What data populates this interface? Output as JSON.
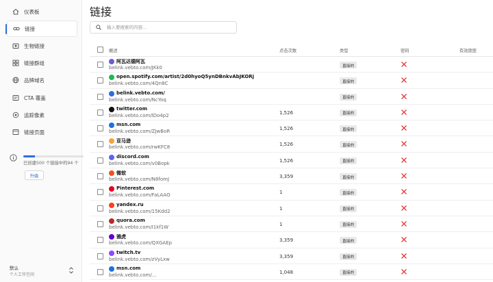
{
  "sidebar": {
    "items": [
      {
        "label": "仪表板",
        "icon": "home-icon",
        "active": false
      },
      {
        "label": "链接",
        "icon": "link-icon",
        "active": true
      },
      {
        "label": "生物链接",
        "icon": "bio-link-icon",
        "active": false
      },
      {
        "label": "链接群组",
        "icon": "grid-icon",
        "active": false
      },
      {
        "label": "品牌域名",
        "icon": "globe-icon",
        "active": false
      },
      {
        "label": "CTA 覆盖",
        "icon": "overlay-icon",
        "active": false
      },
      {
        "label": "追踪像素",
        "icon": "pixel-icon",
        "active": false
      },
      {
        "label": "链接页面",
        "icon": "page-icon",
        "active": false
      }
    ],
    "quota": {
      "text": "已创建500 个链接中的94 个",
      "used": 94,
      "total": 500
    },
    "upgrade_label": "升级",
    "workspace": {
      "name": "默认",
      "subtitle": "个人工作空间"
    }
  },
  "main": {
    "title": "链接",
    "search": {
      "placeholder": "输入要搜索的内容..."
    },
    "columns": {
      "overview": "概述",
      "clicks": "点击次数",
      "type": "类型",
      "password": "密码",
      "expires": "有效期至"
    },
    "rows": [
      {
        "name": "阿瓦达德阿瓦",
        "short": "belink.vebto.com/JKk0",
        "clicks": "",
        "type": "直接的",
        "icon_color": "#6b5bd6"
      },
      {
        "name": "open.spotify.com/artist/2d0hyoQ5ynDBnkvAbJKORj",
        "short": "belink.vebto.com/4Qn8C",
        "clicks": "",
        "type": "直接的",
        "icon_color": "#1db954"
      },
      {
        "name": "belink.vebto.com/",
        "short": "belink.vebto.com/NcYoq",
        "clicks": "",
        "type": "直接的",
        "icon_color": "#2d6cdf"
      },
      {
        "name": "twitter.com",
        "short": "belink.vebto.com/lDo4p2",
        "clicks": "1,526",
        "type": "直接的",
        "icon_color": "#111111"
      },
      {
        "name": "msn.com",
        "short": "belink.vebto.com/ZJwBoR",
        "clicks": "1,526",
        "type": "直接的",
        "icon_color": "#1f6fe0"
      },
      {
        "name": "亚马逊",
        "short": "belink.vebto.com/rwKFC8",
        "clicks": "1,526",
        "type": "直接的",
        "icon_color": "#f2a33a"
      },
      {
        "name": "discord.com",
        "short": "belink.vebto.com/v0Bopk",
        "clicks": "1,526",
        "type": "直接的",
        "icon_color": "#5865f2"
      },
      {
        "name": "微软",
        "short": "belink.vebto.com/N8fomJ",
        "clicks": "3,359",
        "type": "直接的",
        "icon_color": "#f25022"
      },
      {
        "name": "Pinterest.com",
        "short": "belink.vebto.com/FaLAAO",
        "clicks": "1",
        "type": "直接的",
        "icon_color": "#e60023"
      },
      {
        "name": "yandex.ru",
        "short": "belink.vebto.com/15Kdd2",
        "clicks": "1",
        "type": "直接的",
        "icon_color": "#fc3f1d"
      },
      {
        "name": "quora.com",
        "short": "belink.vebto.com/I1kf1W",
        "clicks": "1",
        "type": "直接的",
        "icon_color": "#b92b27"
      },
      {
        "name": "雅虎",
        "short": "belink.vebto.com/QXGAEp",
        "clicks": "3,359",
        "type": "直接的",
        "icon_color": "#6001d2"
      },
      {
        "name": "twitch.tv",
        "short": "belink.vebto.com/zVyLxw",
        "clicks": "3,359",
        "type": "直接的",
        "icon_color": "#9146ff"
      },
      {
        "name": "msn.com",
        "short": "belink.vebto.com/…",
        "clicks": "1,048",
        "type": "直接的",
        "icon_color": "#1f6fe0"
      }
    ]
  },
  "colors": {
    "accent": "#2d6cdf",
    "danger": "#e23b3b"
  }
}
